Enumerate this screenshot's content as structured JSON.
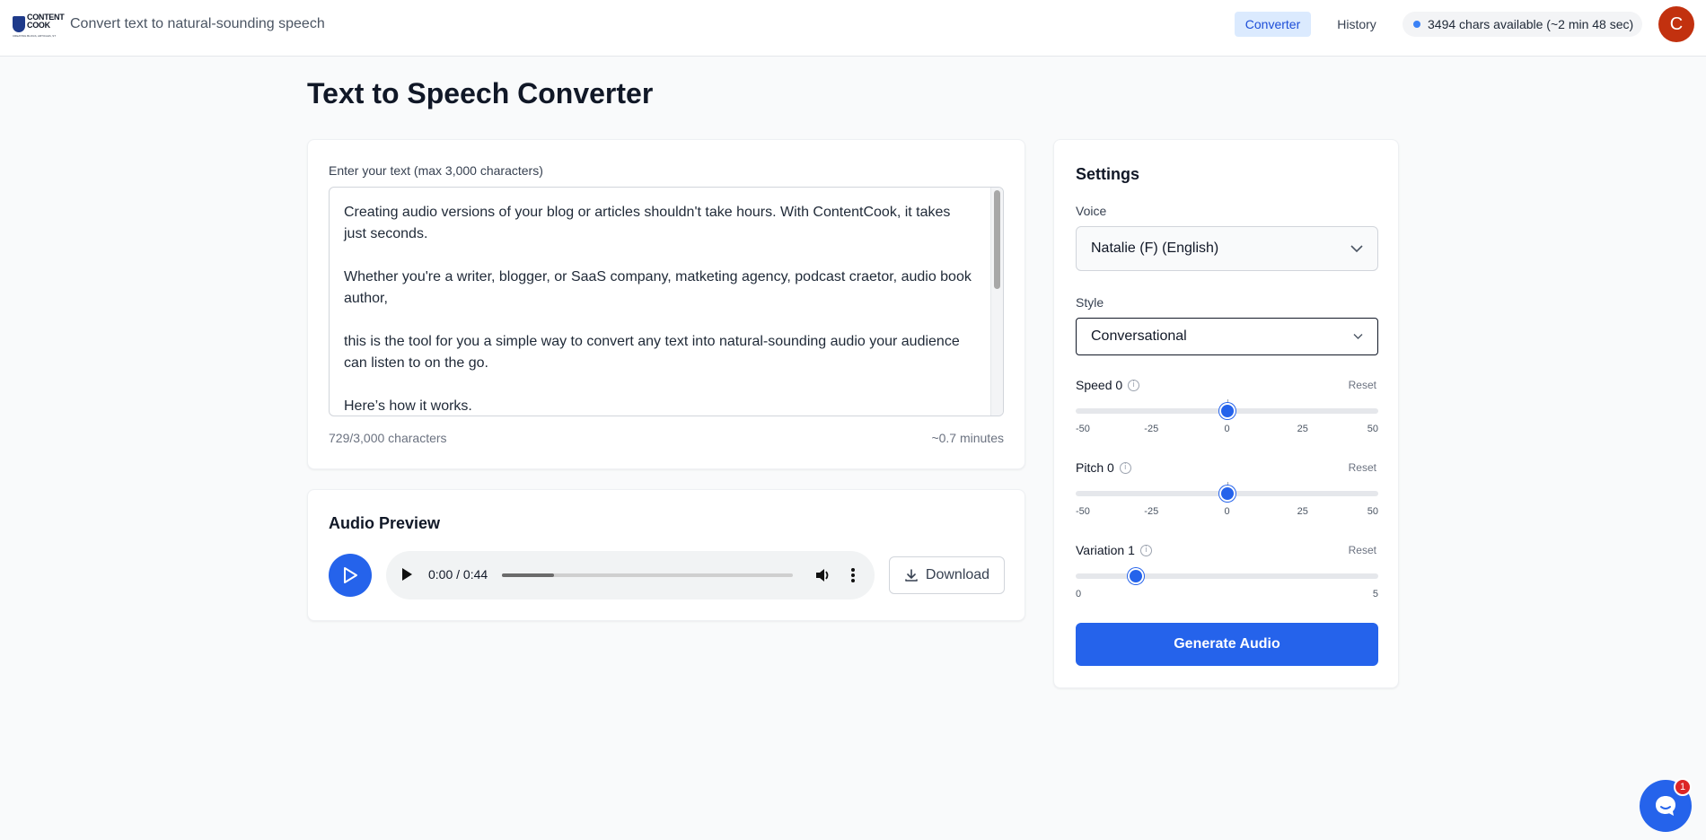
{
  "header": {
    "logo_text_line1": "CONTENT",
    "logo_text_line2": "COOK",
    "logo_tagline": "CREATING BLOGS, ARTICLES, STORIES",
    "subtitle": "Convert text to natural-sounding speech",
    "nav": [
      {
        "label": "Converter",
        "active": true
      },
      {
        "label": "History",
        "active": false
      }
    ],
    "chars_available": "3494 chars available (~2 min 48 sec)",
    "avatar_initial": "C"
  },
  "page": {
    "title": "Text to Speech Converter"
  },
  "editor": {
    "label": "Enter your text (max 3,000 characters)",
    "text": "Creating audio versions of your blog or articles shouldn't take hours. With ContentCook, it takes just seconds.\n\nWhether you're a writer, blogger, or SaaS company, matketing agency, podcast craetor, audio book author,\n\nthis is the tool for you a simple way to convert any text into natural-sounding audio your audience can listen to on the go.\n\nHere’s how it works.",
    "char_count": "729/3,000 characters",
    "minutes": "~0.7 minutes"
  },
  "audio": {
    "title": "Audio Preview",
    "time": "0:00 / 0:44",
    "buffered_fraction": 0.18,
    "download_label": "Download"
  },
  "settings": {
    "title": "Settings",
    "voice_label": "Voice",
    "voice_value": "Natalie (F) (English)",
    "style_label": "Style",
    "style_value": "Conversational",
    "reset_label": "Reset",
    "speed": {
      "label": "Speed 0",
      "value": 0,
      "min": -50,
      "max": 50,
      "ticks": [
        "-50",
        "-25",
        "0",
        "25",
        "50"
      ]
    },
    "pitch": {
      "label": "Pitch 0",
      "value": 0,
      "min": -50,
      "max": 50,
      "ticks": [
        "-50",
        "-25",
        "0",
        "25",
        "50"
      ]
    },
    "variation": {
      "label": "Variation 1",
      "value": 1,
      "min": 0,
      "max": 5,
      "ticks": [
        "0",
        "5"
      ]
    },
    "generate_label": "Generate Audio"
  },
  "chat": {
    "badge_count": "1"
  },
  "colors": {
    "primary": "#2563eb",
    "avatar": "#c2310f",
    "badge": "#dc2626"
  }
}
